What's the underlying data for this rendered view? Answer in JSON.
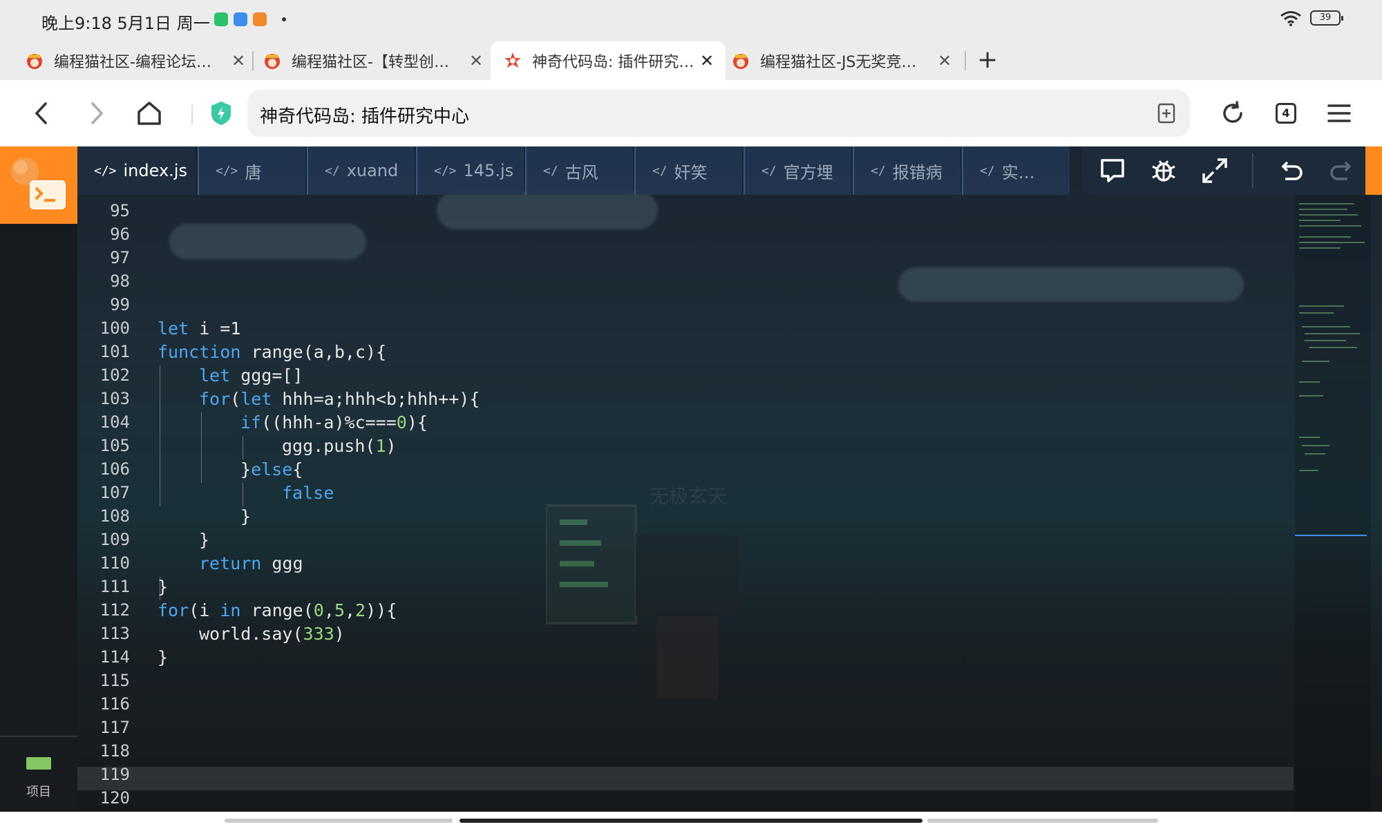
{
  "status": {
    "time": "晚上9:18  5月1日  周一",
    "battery": "39"
  },
  "tabs": [
    {
      "title": "编程猫社区-编程论坛…",
      "active": false
    },
    {
      "title": "编程猫社区-【转型创…",
      "active": false
    },
    {
      "title": "神奇代码岛: 插件研究…",
      "active": true
    },
    {
      "title": "编程猫社区-JS无奖竞…",
      "active": false
    }
  ],
  "tab_count": "4",
  "url_title": "神奇代码岛: 插件研究中心",
  "file_tabs": [
    {
      "glyph": "</>",
      "label": "index.js"
    },
    {
      "glyph": "</>",
      "label": "唐"
    },
    {
      "glyph": "</",
      "label": "xuand"
    },
    {
      "glyph": "</>",
      "label": "145.js"
    },
    {
      "glyph": "</",
      "label": "古风"
    },
    {
      "glyph": "</",
      "label": "奸笑"
    },
    {
      "glyph": "</",
      "label": "官方埋"
    },
    {
      "glyph": "</",
      "label": "报错病"
    },
    {
      "glyph": "</",
      "label": "实…"
    }
  ],
  "line_numbers": [
    "95",
    "96",
    "97",
    "98",
    "99",
    "100",
    "101",
    "102",
    "103",
    "104",
    "105",
    "106",
    "107",
    "108",
    "109",
    "110",
    "111",
    "112",
    "113",
    "114",
    "115",
    "116",
    "117",
    "118",
    "119",
    "120"
  ],
  "code_lines": {
    "l100": {
      "kw": "let",
      "rest": " i =1"
    },
    "l101": {
      "kw": "function",
      "rest": " range(a,b,c){"
    },
    "l102": {
      "kw": "let",
      "rest": " ggg=[]"
    },
    "l103": {
      "kw1": "for",
      "p1": "(",
      "kw2": "let",
      "rest": " hhh=a;hhh<b;hhh++){"
    },
    "l104": {
      "kw": "if",
      "rest": "((hhh-a)%c===",
      "num": "0",
      "end": "){"
    },
    "l105": {
      "pre": "ggg.push(",
      "num": "1",
      "end": ")"
    },
    "l106": {
      "pre": "}",
      "kw": "else",
      "end": "{"
    },
    "l107": {
      "kw": "false"
    },
    "l108": {
      "pre": "}"
    },
    "l109": {
      "pre": "}"
    },
    "l110": {
      "kw": "return",
      "rest": " ggg"
    },
    "l111": {
      "pre": "}"
    },
    "l112": {
      "kw1": "for",
      "p1": "(i ",
      "kw2": "in",
      "rest": " range(",
      "n1": "0",
      "c1": ",",
      "n2": "5",
      "c2": ",",
      "n3": "2",
      "end": ")){"
    },
    "l113": {
      "pre": "world.say(",
      "num": "333",
      "end": ")"
    },
    "l114": {
      "pre": "}"
    }
  },
  "sidebar": {
    "project_label": "项目"
  },
  "watermark": "无极玄天",
  "colors": {
    "accent": "#ff8a1f",
    "keyword": "#4ca8f0",
    "number": "#9cd67a"
  }
}
